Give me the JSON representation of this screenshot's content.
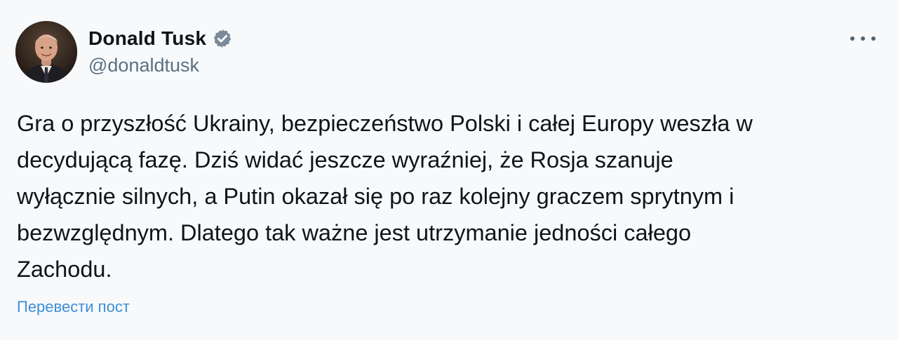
{
  "author": {
    "display_name": "Donald Tusk",
    "handle": "@donaldtusk",
    "verified": true,
    "avatar_icon": "user-avatar"
  },
  "post": {
    "text": "Gra o przyszłość Ukrainy, bezpieczeństwo Polski i całej Europy weszła w\ndecydującą fazę. Dziś widać jeszcze wyraźniej, że Rosja szanuje\nwyłącznie silnych, a Putin okazał się po raz kolejny graczem sprytnym i\nbezwzględnym. Dlatego tak ważne jest utrzymanie jedności całego\nZachodu."
  },
  "actions": {
    "translate_label": "Перевести пост",
    "more_icon": "more-options-icon"
  },
  "colors": {
    "background": "#f7f9fb",
    "text": "#0f1419",
    "secondary": "#5b7083",
    "link": "#3d8fd6",
    "verified_badge": "#7b8a99"
  }
}
